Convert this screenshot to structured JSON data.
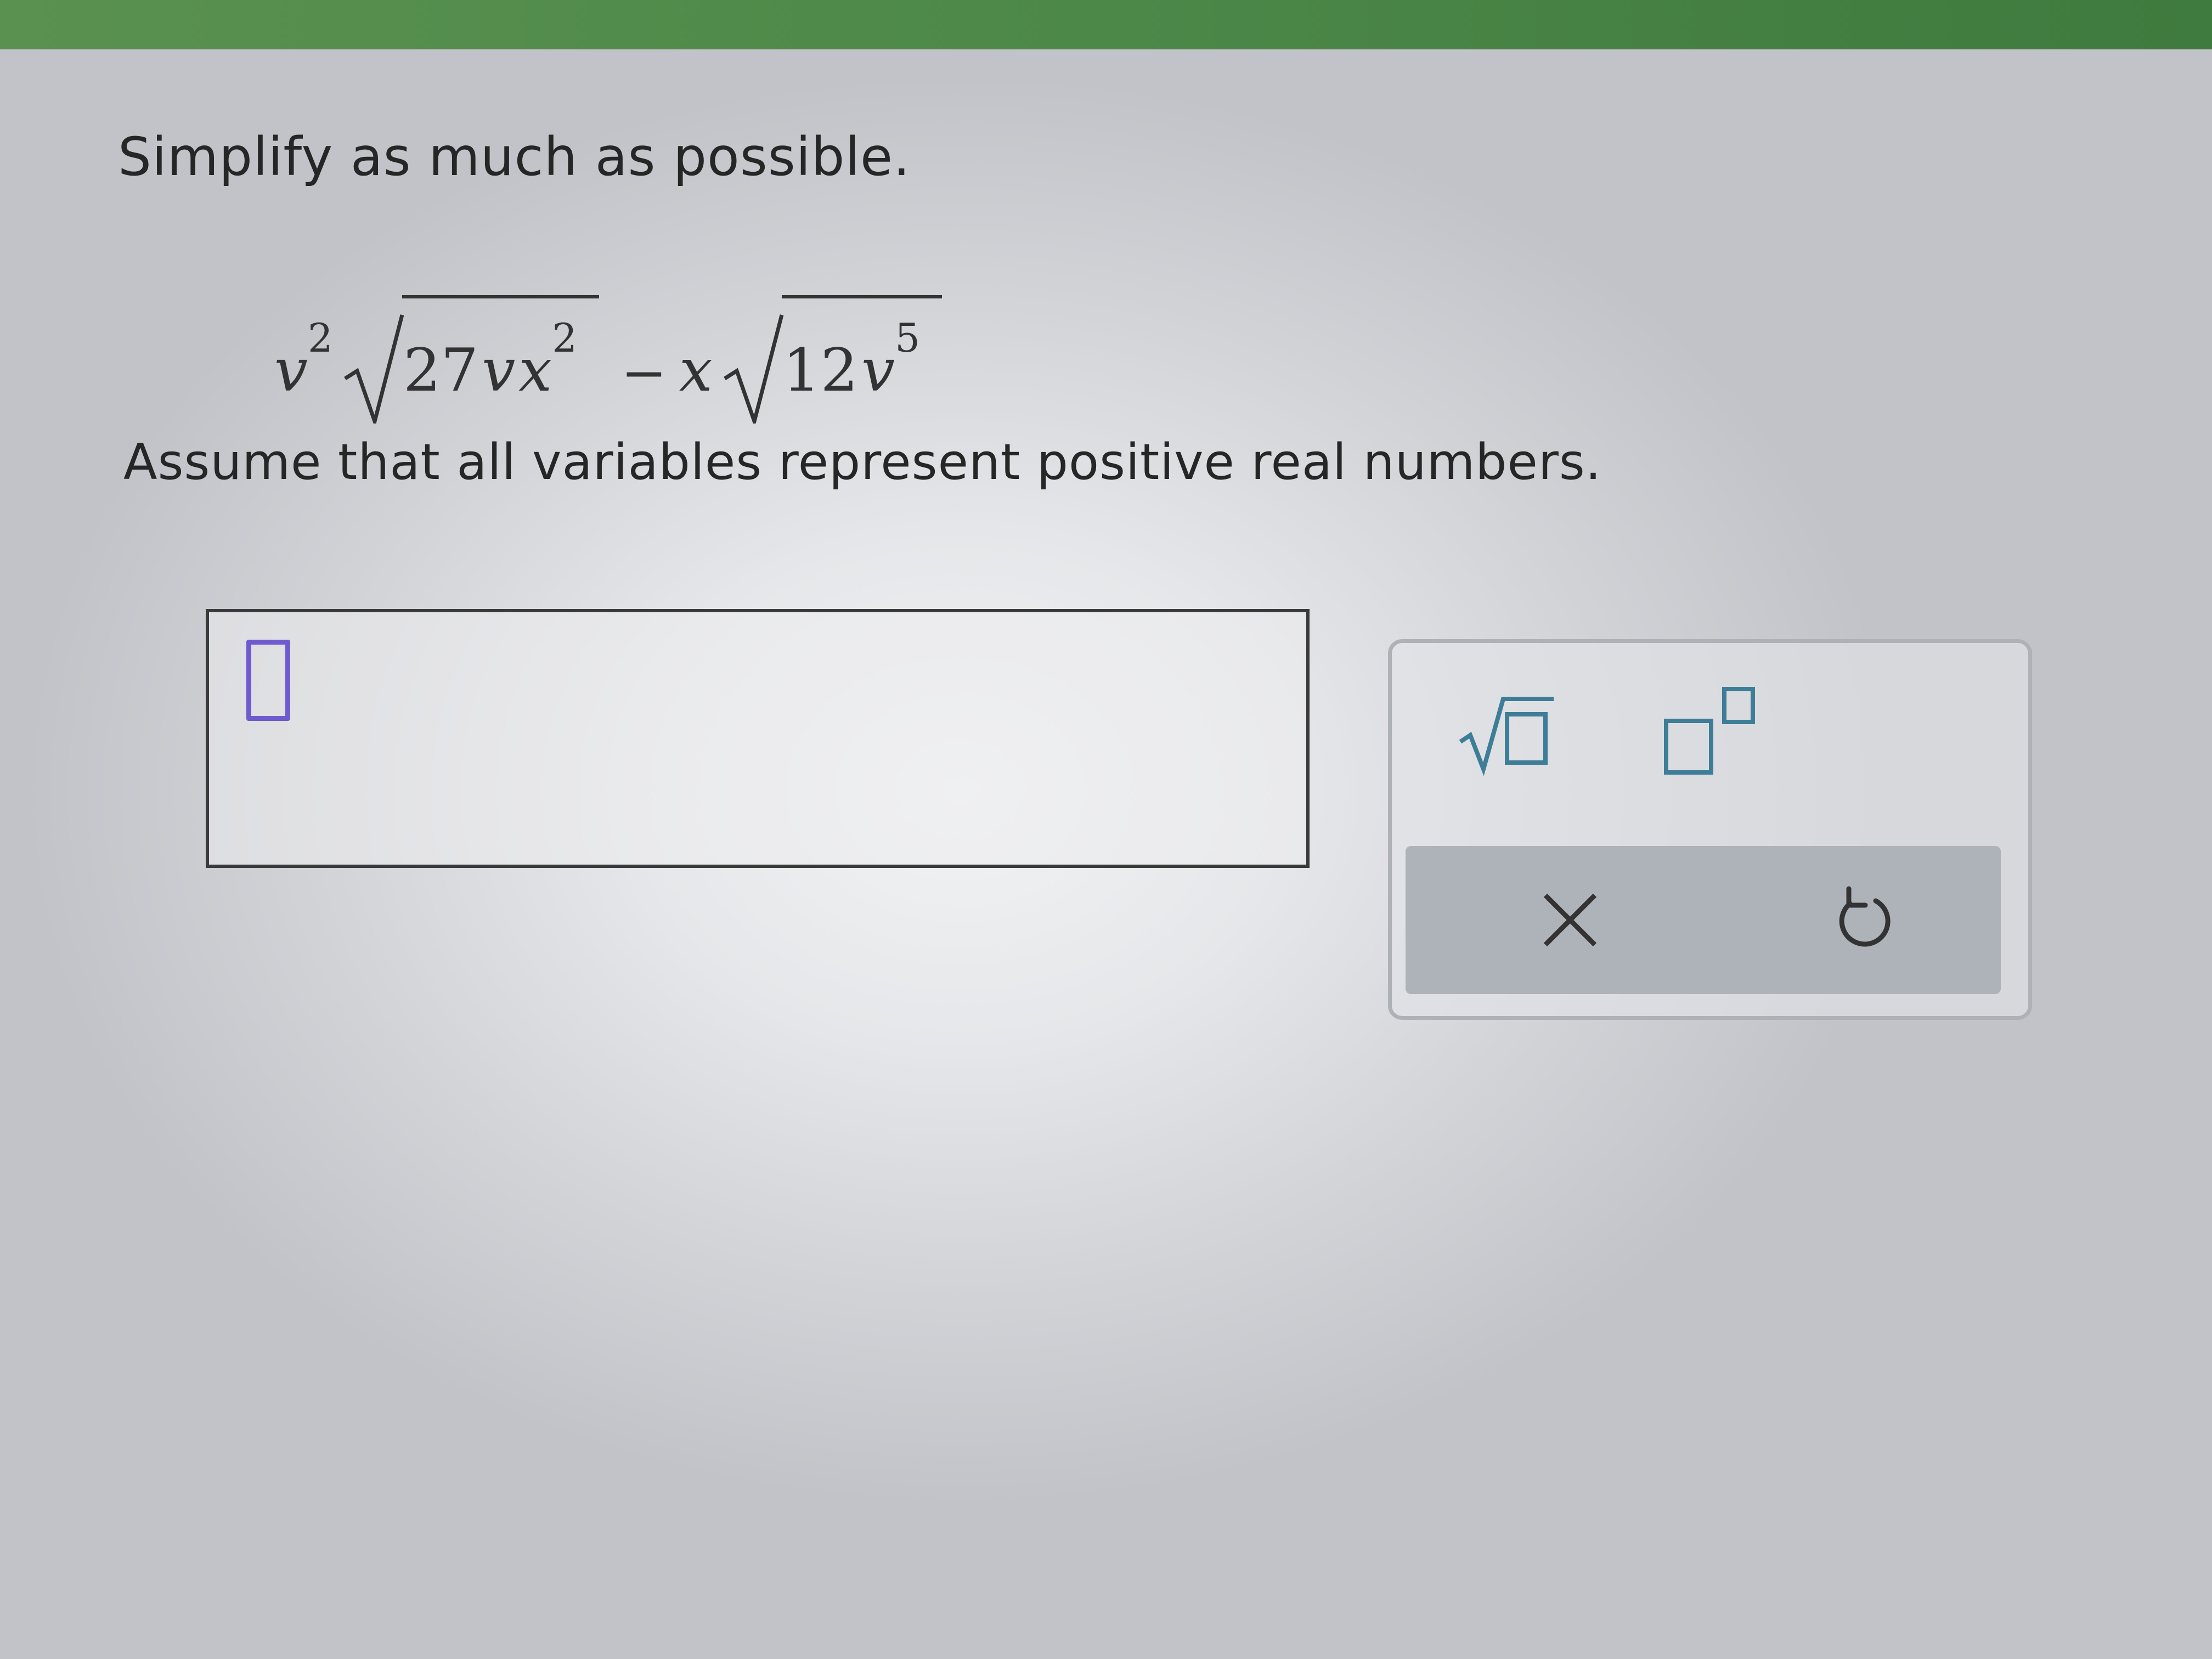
{
  "question": {
    "instruction": "Simplify as much as possible.",
    "expression": {
      "term1_coefficient_var": "v",
      "term1_coefficient_exp": "2",
      "term1_radicand_num": "27",
      "term1_radicand_var1": "v",
      "term1_radicand_var2": "x",
      "term1_radicand_exp": "2",
      "operator": "−",
      "term2_coefficient_var": "x",
      "term2_radicand_num": "12",
      "term2_radicand_var": "v",
      "term2_radicand_exp": "5"
    },
    "note": "Assume that all variables represent positive real numbers."
  },
  "answer": {
    "value": ""
  },
  "keypad": {
    "buttons": [
      {
        "icon": "square-root-icon"
      },
      {
        "icon": "superscript-icon"
      },
      {
        "icon": "clear-icon"
      },
      {
        "icon": "undo-icon"
      }
    ]
  },
  "colors": {
    "top_bar": "#4c8848",
    "caret": "#6f5ad0",
    "keypad_icon": "#3e7d97",
    "actions_bg": "#adb3b8"
  }
}
